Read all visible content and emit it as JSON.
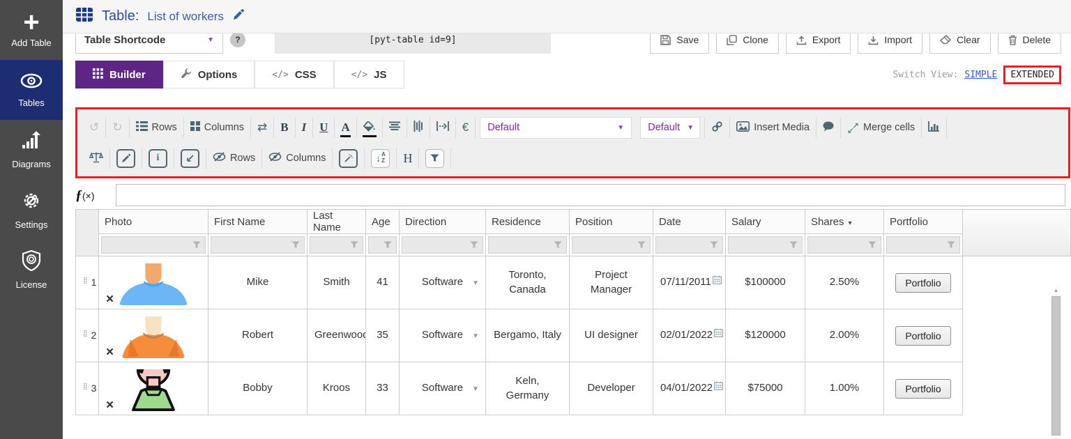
{
  "sidebar": {
    "items": [
      {
        "label": "Add Table"
      },
      {
        "label": "Tables"
      },
      {
        "label": "Diagrams"
      },
      {
        "label": "Settings"
      },
      {
        "label": "License"
      }
    ]
  },
  "header": {
    "title": "Table:",
    "table_name": "List of workers"
  },
  "shortcode_bar": {
    "type_selector": "Table Shortcode",
    "help": "?",
    "shortcode": "[pyt-table id=9]"
  },
  "actions": {
    "save": "Save",
    "clone": "Clone",
    "export": "Export",
    "import": "Import",
    "clear": "Clear",
    "delete": "Delete"
  },
  "tabs": {
    "builder": "Builder",
    "options": "Options",
    "css": "CSS",
    "js": "JS"
  },
  "switch_view": {
    "label": "Switch View:",
    "simple": "SIMPLE",
    "extended": "EXTENDED"
  },
  "toolbar": {
    "rows_label": "Rows",
    "columns_label": "Columns",
    "font_default": "Default",
    "size_default": "Default",
    "insert_media": "Insert Media",
    "merge_cells": "Merge cells",
    "hide_rows": "Rows",
    "hide_columns": "Columns"
  },
  "formula": {
    "value": ""
  },
  "icons": {
    "undo": "↺",
    "redo": "↻",
    "swap": "⇄",
    "currency": "€",
    "bold": "B",
    "italic": "I",
    "underline": "U",
    "font_color": "A",
    "header": "H",
    "dropdown_caret": "▾",
    "select_caret": "▼",
    "sort_caret": "▾",
    "merge_ne": "↗",
    "merge_sw": "↙",
    "delete_photo": "×",
    "drag_handle": "⣿",
    "scroll_up": "▲",
    "code": "</>",
    "sort_arrow": "↓",
    "sort_a": "A",
    "sort_z": "Z",
    "formula_f": "ƒ",
    "formula_x": "(×)"
  },
  "colors": {
    "accent_purple": "#5d2584",
    "sidebar_active_blue": "#1c2d74",
    "annotation_red": "#ea1c24",
    "link_blue": "#2f5bd8",
    "title_blue": "#2d4d9c"
  },
  "grid": {
    "columns": [
      "Photo",
      "First Name",
      "Last Name",
      "Age",
      "Direction",
      "Residence",
      "Position",
      "Date",
      "Salary",
      "Shares",
      "Portfolio"
    ],
    "sorted_column": "Shares",
    "rows": [
      {
        "num": "1",
        "first_name": "Mike",
        "last_name": "Smith",
        "age": "41",
        "direction": "Software",
        "residence": "Toronto, Canada",
        "position": "Project Manager",
        "date": "07/11/2011",
        "salary": "$100000",
        "shares": "2.50%",
        "portfolio": "Portfolio"
      },
      {
        "num": "2",
        "first_name": "Robert",
        "last_name": "Greenwood",
        "age": "35",
        "direction": "Software",
        "residence": "Bergamo, Italy",
        "position": "UI designer",
        "date": "02/01/2022",
        "salary": "$120000",
        "shares": "2.00%",
        "portfolio": "Portfolio"
      },
      {
        "num": "3",
        "first_name": "Bobby",
        "last_name": "Kroos",
        "age": "33",
        "direction": "Software",
        "residence": "Keln, Germany",
        "position": "Developer",
        "date": "04/01/2022",
        "salary": "$75000",
        "shares": "1.00%",
        "portfolio": "Portfolio"
      }
    ]
  }
}
